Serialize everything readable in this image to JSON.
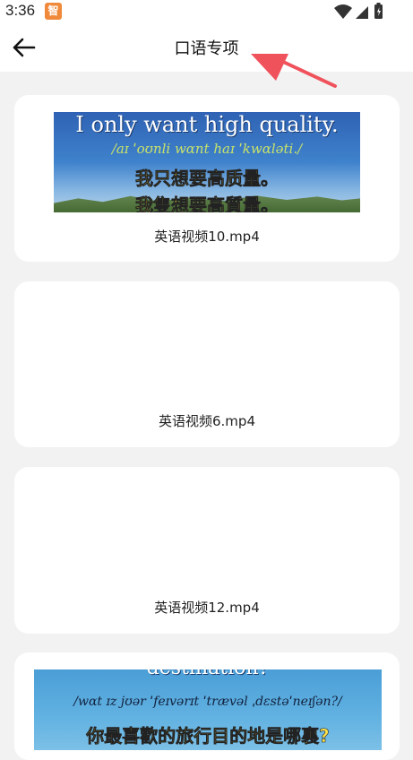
{
  "status": {
    "time": "3:36",
    "app_badge": "智"
  },
  "header": {
    "title": "口语专项"
  },
  "videos": [
    {
      "name": "英语视频10.mp4",
      "thumb": {
        "en": "I only want high quality.",
        "ipa": "/aɪ ˈoʊnli wɑnt haɪ ˈkwɑləti./",
        "zh_simplified": "我只想要高质量。",
        "zh_traditional": "我隻想要高質量。"
      }
    },
    {
      "name": "英语视频6.mp4"
    },
    {
      "name": "英语视频12.mp4"
    },
    {
      "name": "",
      "thumb": {
        "en": "destination?",
        "ipa": "/wɑt ɪz jʊər ˈfeɪvərɪt ˈtrævəl ˌdɛstəˈneɪʃən?/",
        "zh": "你最喜歡的旅行目的地是哪裏?"
      }
    }
  ],
  "colors": {
    "accent_arrow": "#f0525c",
    "page_bg": "#f2f2f2",
    "card_bg": "#ffffff"
  }
}
